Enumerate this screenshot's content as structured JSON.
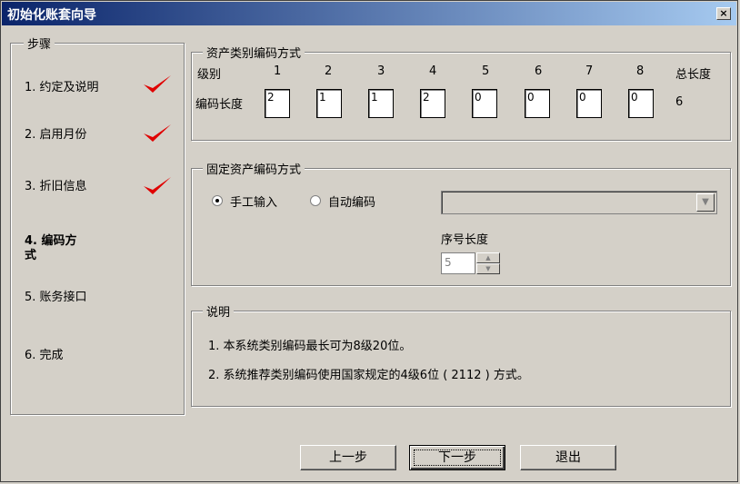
{
  "window": {
    "title": "初始化账套向导",
    "close_glyph": "×"
  },
  "steps": {
    "legend": "步骤",
    "items": [
      {
        "label": "1. 约定及说明",
        "done": true
      },
      {
        "label": "2. 启用月份",
        "done": true
      },
      {
        "label": "3. 折旧信息",
        "done": true
      },
      {
        "label": "4. 编码方式",
        "done": false,
        "current": true
      },
      {
        "label": "5. 账务接口",
        "done": false
      },
      {
        "label": "6. 完成",
        "done": false
      }
    ],
    "current_line1": "4. 编码方",
    "current_line2": "式",
    "check_color": "#e00000"
  },
  "category_coding": {
    "legend": "资产类别编码方式",
    "level_label": "级别",
    "length_label": "编码长度",
    "total_label": "总长度",
    "levels": [
      "1",
      "2",
      "3",
      "4",
      "5",
      "6",
      "7",
      "8"
    ],
    "lengths": [
      "2",
      "1",
      "1",
      "2",
      "0",
      "0",
      "0",
      "0"
    ],
    "total": "6"
  },
  "asset_coding": {
    "legend": "固定资产编码方式",
    "manual_label": "手工输入",
    "auto_label": "自动编码",
    "selected": "manual",
    "serial_label": "序号长度",
    "serial_value": "5",
    "combo_value": ""
  },
  "notes": {
    "legend": "说明",
    "line1": "1. 本系统类别编码最长可为8级20位。",
    "line2": "2. 系统推荐类别编码使用国家规定的4级6位 ( 2112 ) 方式。"
  },
  "buttons": {
    "prev": "上一步",
    "next": "下一步",
    "exit": "退出"
  }
}
